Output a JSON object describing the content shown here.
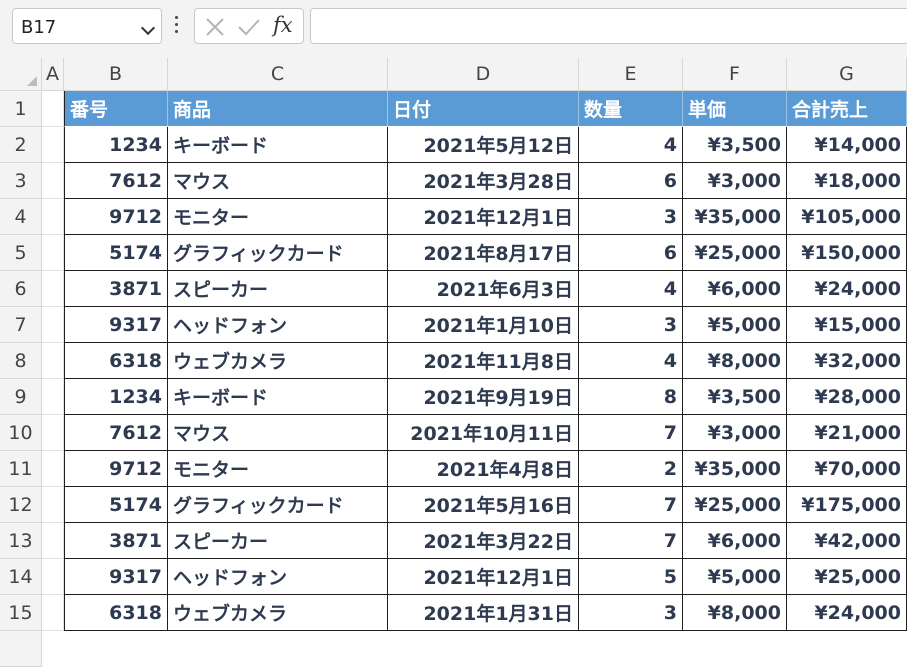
{
  "name_box": {
    "value": "B17"
  },
  "fx_label": "fx",
  "columns": [
    "A",
    "B",
    "C",
    "D",
    "E",
    "F",
    "G"
  ],
  "rows": [
    "1",
    "2",
    "3",
    "4",
    "5",
    "6",
    "7",
    "8",
    "9",
    "10",
    "11",
    "12",
    "13",
    "14",
    "15"
  ],
  "table": {
    "headers": [
      "番号",
      "商品",
      "日付",
      "数量",
      "単価",
      "合計売上"
    ],
    "data": [
      [
        "1234",
        "キーボード",
        "2021年5月12日",
        "4",
        "¥3,500",
        "¥14,000"
      ],
      [
        "7612",
        "マウス",
        "2021年3月28日",
        "6",
        "¥3,000",
        "¥18,000"
      ],
      [
        "9712",
        "モニター",
        "2021年12月1日",
        "3",
        "¥35,000",
        "¥105,000"
      ],
      [
        "5174",
        "グラフィックカード",
        "2021年8月17日",
        "6",
        "¥25,000",
        "¥150,000"
      ],
      [
        "3871",
        "スピーカー",
        "2021年6月3日",
        "4",
        "¥6,000",
        "¥24,000"
      ],
      [
        "9317",
        "ヘッドフォン",
        "2021年1月10日",
        "3",
        "¥5,000",
        "¥15,000"
      ],
      [
        "6318",
        "ウェブカメラ",
        "2021年11月8日",
        "4",
        "¥8,000",
        "¥32,000"
      ],
      [
        "1234",
        "キーボード",
        "2021年9月19日",
        "8",
        "¥3,500",
        "¥28,000"
      ],
      [
        "7612",
        "マウス",
        "2021年10月11日",
        "7",
        "¥3,000",
        "¥21,000"
      ],
      [
        "9712",
        "モニター",
        "2021年4月8日",
        "2",
        "¥35,000",
        "¥70,000"
      ],
      [
        "5174",
        "グラフィックカード",
        "2021年5月16日",
        "7",
        "¥25,000",
        "¥175,000"
      ],
      [
        "3871",
        "スピーカー",
        "2021年3月22日",
        "7",
        "¥6,000",
        "¥42,000"
      ],
      [
        "9317",
        "ヘッドフォン",
        "2021年12月1日",
        "5",
        "¥5,000",
        "¥25,000"
      ],
      [
        "6318",
        "ウェブカメラ",
        "2021年1月31日",
        "3",
        "¥8,000",
        "¥24,000"
      ]
    ]
  },
  "colors": {
    "header_fill": "#5b9bd5",
    "header_text": "#ffffff",
    "cell_text": "#2e3a4f"
  }
}
